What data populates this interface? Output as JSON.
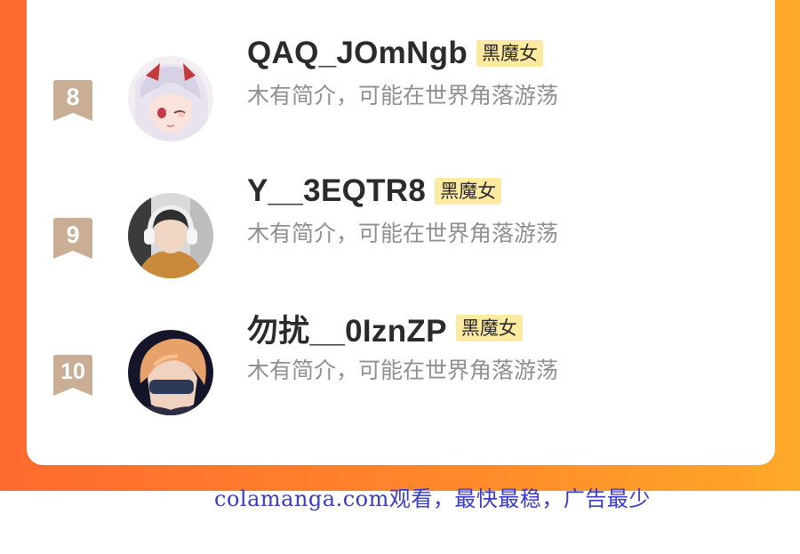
{
  "colors": {
    "accent_gradient_start": "#ff6a2f",
    "accent_gradient_end": "#ffa928",
    "badge_bg": "#fdeaa1",
    "rank_badge": "#c9ad94",
    "watermark": "#3a3ac8"
  },
  "rows": [
    {
      "rank": "8",
      "name": "QAQ_JOmNgb",
      "badge": "黑魔女",
      "bio": "木有简介，可能在世界角落游荡"
    },
    {
      "rank": "9",
      "name": "Y__3EQTR8",
      "badge": "黑魔女",
      "bio": "木有简介，可能在世界角落游荡"
    },
    {
      "rank": "10",
      "name": "勿扰__0IznZP",
      "badge": "黑魔女",
      "bio": "木有简介，可能在世界角落游荡"
    }
  ],
  "watermark": "colamanga.com观看，最快最稳，广告最少"
}
